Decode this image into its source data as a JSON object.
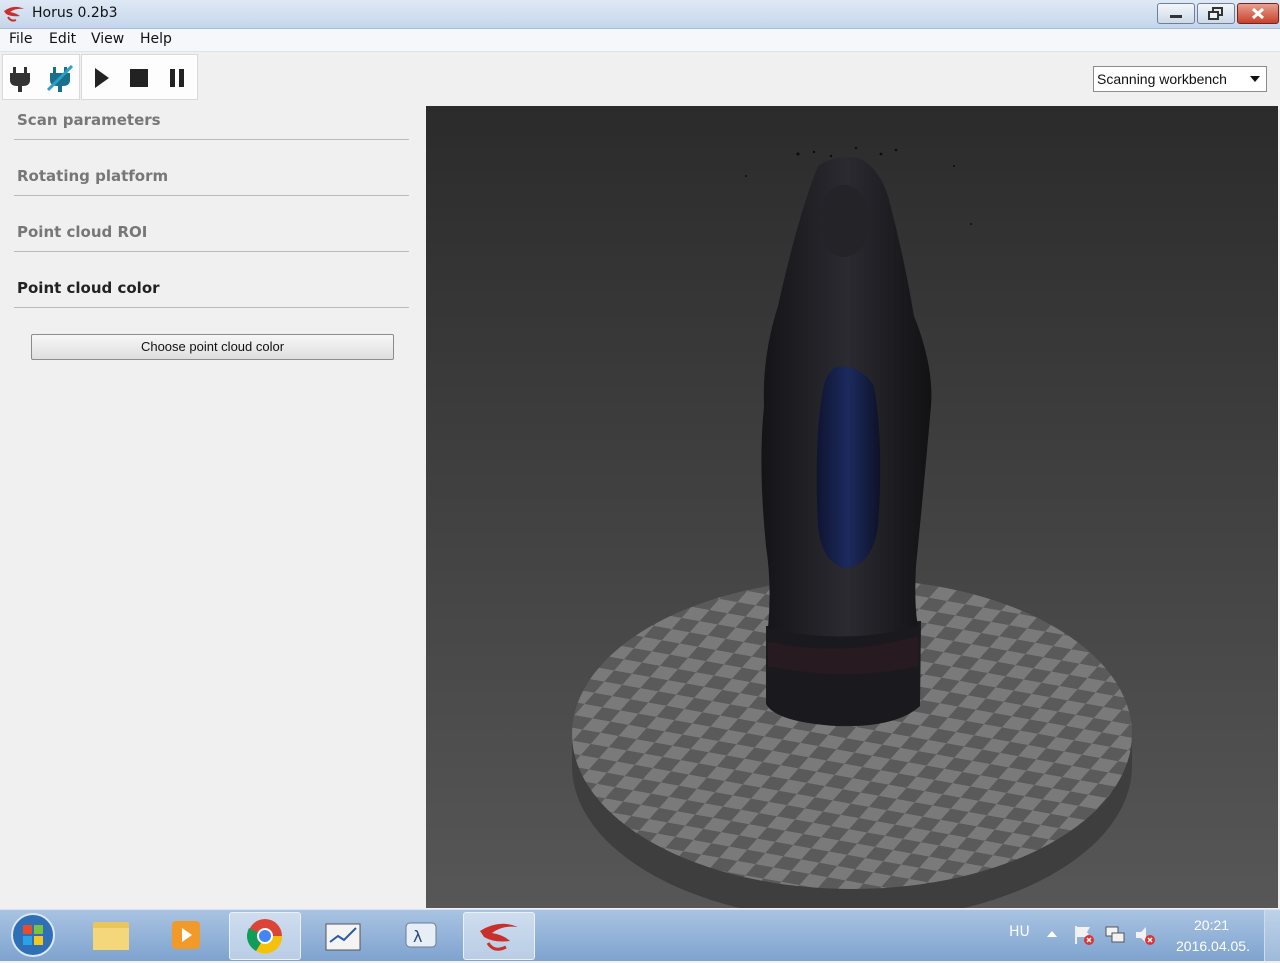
{
  "window": {
    "title": "Horus 0.2b3"
  },
  "menu": {
    "items": [
      {
        "label": "File"
      },
      {
        "label": "Edit"
      },
      {
        "label": "View"
      },
      {
        "label": "Help"
      }
    ]
  },
  "toolbar": {
    "buttons": [
      {
        "icon": "connect-plug-icon"
      },
      {
        "icon": "disconnect-plug-icon"
      },
      {
        "icon": "play-icon"
      },
      {
        "icon": "stop-icon"
      },
      {
        "icon": "pause-icon"
      }
    ],
    "workbench": {
      "value": "Scanning workbench",
      "icon": "chevron-down-icon"
    }
  },
  "panel": {
    "sections": [
      {
        "label": "Scan parameters",
        "active": false
      },
      {
        "label": "Rotating platform",
        "active": false
      },
      {
        "label": "Point cloud ROI",
        "active": false
      },
      {
        "label": "Point cloud color",
        "active": true
      }
    ],
    "choose_color_label": "Choose point cloud color"
  },
  "colors": {
    "platform_light": "#7a7a7a",
    "platform_dark": "#5a5a5a",
    "statue_dark": "#1d1d22",
    "robe_blue": "#16204a",
    "taskbar": "#8fb0d8",
    "close_button": "#c8412a"
  },
  "taskbar": {
    "apps": [
      {
        "icon": "windows-start-icon"
      },
      {
        "icon": "file-explorer-icon"
      },
      {
        "icon": "media-player-icon"
      },
      {
        "icon": "chrome-icon"
      },
      {
        "icon": "whiteboard-icon"
      },
      {
        "icon": "lambda-app-icon"
      },
      {
        "icon": "horus-app-icon"
      }
    ],
    "language": "HU",
    "time": "20:21",
    "date": "2016.04.05."
  }
}
